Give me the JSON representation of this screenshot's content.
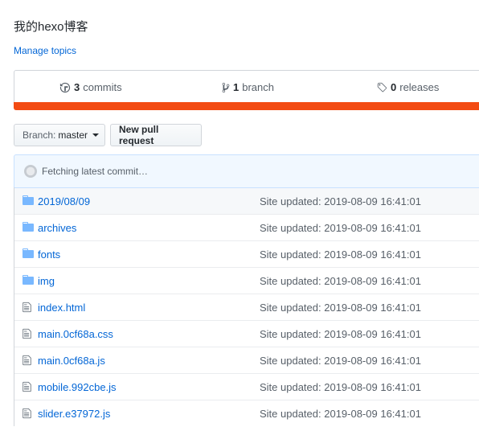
{
  "repo": {
    "description": "我的hexo博客",
    "manage_topics": "Manage topics"
  },
  "summary": {
    "commits": {
      "count": "3",
      "label": "commits",
      "icon": "history-icon"
    },
    "branches": {
      "count": "1",
      "label": "branch",
      "icon": "branch-icon"
    },
    "releases": {
      "count": "0",
      "label": "releases",
      "icon": "tag-icon"
    },
    "language_bar_color": "#f34b13"
  },
  "toolbar": {
    "branch_prefix": "Branch:",
    "branch_name": "master",
    "new_pr": "New pull request"
  },
  "commit_bar": {
    "text": "Fetching latest commit…"
  },
  "files": [
    {
      "name": "2019/08/09",
      "type": "dir",
      "message": "Site updated: 2019-08-09 16:41:01"
    },
    {
      "name": "archives",
      "type": "dir",
      "message": "Site updated: 2019-08-09 16:41:01"
    },
    {
      "name": "fonts",
      "type": "dir",
      "message": "Site updated: 2019-08-09 16:41:01"
    },
    {
      "name": "img",
      "type": "dir",
      "message": "Site updated: 2019-08-09 16:41:01"
    },
    {
      "name": "index.html",
      "type": "file",
      "message": "Site updated: 2019-08-09 16:41:01"
    },
    {
      "name": "main.0cf68a.css",
      "type": "file",
      "message": "Site updated: 2019-08-09 16:41:01"
    },
    {
      "name": "main.0cf68a.js",
      "type": "file",
      "message": "Site updated: 2019-08-09 16:41:01"
    },
    {
      "name": "mobile.992cbe.js",
      "type": "file",
      "message": "Site updated: 2019-08-09 16:41:01"
    },
    {
      "name": "slider.e37972.js",
      "type": "file",
      "message": "Site updated: 2019-08-09 16:41:01"
    }
  ]
}
